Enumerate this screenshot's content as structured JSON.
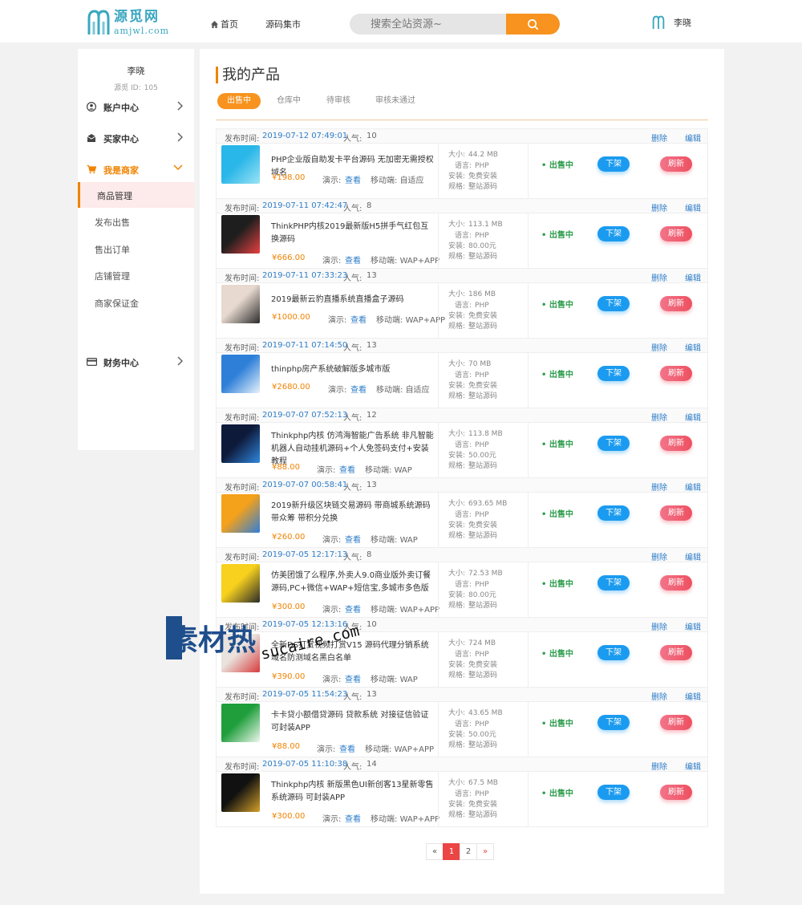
{
  "header": {
    "logo_cn": "源觅网",
    "logo_en": "amjwl.com",
    "nav_home": "首页",
    "nav_market": "源码集市",
    "search_placeholder": "搜索全站资源~",
    "user_name": "李晓"
  },
  "sidebar": {
    "user_name": "李晓",
    "id_label": "源觅 ID:",
    "id_value": "105",
    "menus": [
      {
        "label": "账户中心"
      },
      {
        "label": "买家中心"
      },
      {
        "label": "我是商家"
      },
      {
        "label": "财务中心"
      }
    ],
    "sub_items": [
      {
        "label": "商品管理"
      },
      {
        "label": "发布出售"
      },
      {
        "label": "售出订单"
      },
      {
        "label": "店铺管理"
      },
      {
        "label": "商家保证金"
      }
    ]
  },
  "main": {
    "title": "我的产品",
    "tabs": [
      {
        "label": "出售中"
      },
      {
        "label": "仓库中"
      },
      {
        "label": "待审核"
      },
      {
        "label": "审核未通过"
      }
    ]
  },
  "labels": {
    "publish_time": "发布时间:",
    "popularity": "人气:",
    "delete": "删除",
    "edit": "编辑",
    "demo": "演示:",
    "demo_link": "查看",
    "mobile": "移动端:",
    "size": "大小:",
    "language": "语言:",
    "install": "安装:",
    "spec": "规格:",
    "status": "出售中",
    "btn_list": "下架",
    "btn_refresh": "刷新"
  },
  "products": [
    {
      "time": "2019-07-12 07:49:01",
      "pop": "10",
      "title": "PHP企业版自助发卡平台源码 无加密无需授权域名",
      "price": "¥198.00",
      "mobile": "自适应",
      "size": "44.2 MB",
      "lang": "PHP",
      "install": "免费安装",
      "spec": "整站源码"
    },
    {
      "time": "2019-07-11 07:42:47",
      "pop": "8",
      "title": "ThinkPHP内核2019最新版H5拼手气红包互换源码",
      "price": "¥666.00",
      "mobile": "WAP+APP",
      "size": "113.1 MB",
      "lang": "PHP",
      "install": "80.00元",
      "spec": "整站源码"
    },
    {
      "time": "2019-07-11 07:33:23",
      "pop": "13",
      "title": "2019最新云豹直播系统直播盒子源码",
      "price": "¥1000.00",
      "mobile": "WAP+APP",
      "size": "186 MB",
      "lang": "PHP",
      "install": "免费安装",
      "spec": "整站源码"
    },
    {
      "time": "2019-07-11 07:14:50",
      "pop": "13",
      "title": "thinphp房产系统破解版多城市版",
      "price": "¥2680.00",
      "mobile": "自适应",
      "size": "70 MB",
      "lang": "PHP",
      "install": "免费安装",
      "spec": "整站源码"
    },
    {
      "time": "2019-07-07 07:52:13",
      "pop": "12",
      "title": "Thinkphp内核 仿鸿海智能广告系统 非凡智能机器人自动挂机源码+个人免签码支付+安装教程",
      "price": "¥88.00",
      "mobile": "WAP",
      "size": "113.8 MB",
      "lang": "PHP",
      "install": "50.00元",
      "spec": "整站源码"
    },
    {
      "time": "2019-07-07 00:58:41",
      "pop": "13",
      "title": "2019新升级区块链交易源码 带商城系统源码 带众筹 带积分兑换",
      "price": "¥260.00",
      "mobile": "WAP",
      "size": "693.65 MB",
      "lang": "PHP",
      "install": "免费安装",
      "spec": "整站源码"
    },
    {
      "time": "2019-07-05 12:17:13",
      "pop": "8",
      "title": "仿美团饿了么程序,外卖人9.0商业版外卖订餐源码,PC+微信+WAP+短信宝,多城市多色版",
      "price": "¥300.00",
      "mobile": "WAP+APP",
      "size": "72.53 MB",
      "lang": "PHP",
      "install": "80.00元",
      "spec": "整站源码"
    },
    {
      "time": "2019-07-05 12:13:16",
      "pop": "10",
      "title": "全新DS打赏视频打赏V15 源码代理分销系统 域名防测域名黑白名单",
      "price": "¥390.00",
      "mobile": "WAP",
      "size": "724 MB",
      "lang": "PHP",
      "install": "免费安装",
      "spec": "整站源码"
    },
    {
      "time": "2019-07-05 11:54:23",
      "pop": "13",
      "title": "卡卡贷小额借贷源码 贷款系统 对接征信验证 可封装APP",
      "price": "¥88.00",
      "mobile": "WAP+APP",
      "size": "43.65 MB",
      "lang": "PHP",
      "install": "50.00元",
      "spec": "整站源码"
    },
    {
      "time": "2019-07-05 11:10:38",
      "pop": "14",
      "title": "Thinkphp内核 新版黑色UI新创客13星新零售系统源码 可封装APP",
      "price": "¥300.00",
      "mobile": "WAP+APP",
      "size": "67.5 MB",
      "lang": "PHP",
      "install": "免费安装",
      "spec": "整站源码"
    }
  ],
  "pager": {
    "prev": "«",
    "pages": [
      "1",
      "2"
    ],
    "next": "»"
  },
  "watermark": {
    "cn": "素材热",
    "en": "sucaire.com"
  }
}
